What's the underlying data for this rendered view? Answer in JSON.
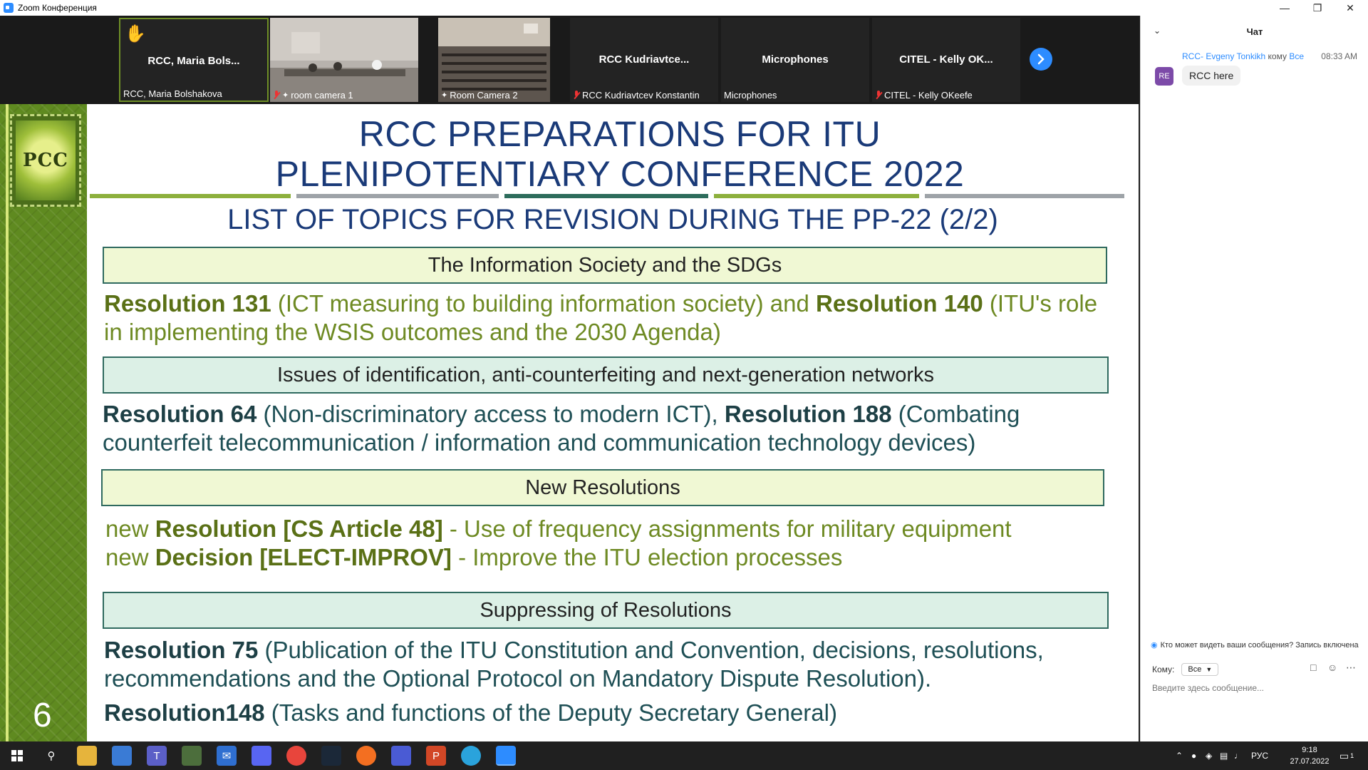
{
  "window": {
    "title": "Zoom Конференция"
  },
  "participants": [
    {
      "center_name": "RCC, Maria Bols...",
      "label": "RCC, Maria Bolshakova",
      "hand_raised": true,
      "muted": false,
      "pinned": false,
      "active": true,
      "video": false
    },
    {
      "center_name": "",
      "label": "room camera 1",
      "hand_raised": false,
      "muted": true,
      "pinned": true,
      "active": false,
      "video": true
    },
    {
      "center_name": "",
      "label": "Room Camera 2",
      "hand_raised": false,
      "muted": false,
      "pinned": true,
      "active": false,
      "video": true
    },
    {
      "center_name": "RCC  Kudriavtce...",
      "label": "RCC Kudriavtcev Konstantin",
      "hand_raised": false,
      "muted": true,
      "pinned": false,
      "active": false,
      "video": false
    },
    {
      "center_name": "Microphones",
      "label": "Microphones",
      "hand_raised": false,
      "muted": false,
      "pinned": false,
      "active": false,
      "video": false
    },
    {
      "center_name": "CITEL - Kelly OK...",
      "label": "CITEL - Kelly OKeefe",
      "hand_raised": false,
      "muted": true,
      "pinned": false,
      "active": false,
      "video": false
    }
  ],
  "slide": {
    "logo_text": "PCC",
    "title_line1": "RCC PREPARATIONS FOR ITU",
    "title_line2": "PLENIPOTENTIARY CONFERENCE 2022",
    "subtitle": "LIST OF TOPICS FOR REVISION DURING THE PP-22 (2/2)",
    "page_number": "6",
    "sections": [
      {
        "heading": "The Information Society and the SDGs"
      },
      {
        "heading": "Issues of identification, anti-counterfeiting and next-generation networks"
      },
      {
        "heading": "New Resolutions"
      },
      {
        "heading": "Suppressing of Resolutions"
      }
    ],
    "p1": {
      "b1": "Resolution 131",
      "t1": " (ICT measuring to building information society) and ",
      "b2": "Resolution 140",
      "t2": " (ITU's role in implementing the WSIS outcomes and the 2030 Agenda)"
    },
    "p2": {
      "b1": "Resolution  64",
      "t1": " (Non-discriminatory access to modern ICT), ",
      "b2": "Resolution 188",
      "t2": " (Combating counterfeit telecommunication / information and communication technology devices)"
    },
    "p3": {
      "pre1": "new ",
      "b1": "Resolution [CS Article 48]",
      "t1": " - Use of frequency assignments for military equipment",
      "pre2": "new ",
      "b2": "Decision [ELECT-IMPROV]",
      "t2": " - Improve the ITU election processes"
    },
    "p4": {
      "b1": "Resolution 75",
      "t1": " (Publication of the ITU Constitution and Convention, decisions, resolutions, recommendations and the Optional Protocol on Mandatory Dispute Resolution)."
    },
    "p5": {
      "b1": "Resolution148",
      "t1": " (Tasks and functions of the Deputy Secretary General)"
    }
  },
  "chat": {
    "title": "Чат",
    "message": {
      "avatar": "RE",
      "sender": "RCC- Evgeny Tonkikh",
      "to_word": "кому",
      "recipient": "Все",
      "time": "08:33 AM",
      "text": "RCC here"
    },
    "privacy_note": "Кто может видеть ваши сообщения? Запись включена",
    "to_label": "Кому:",
    "to_value": "Все",
    "input_placeholder": "Введите здесь сообщение..."
  },
  "taskbar": {
    "language": "РУС",
    "time": "9:18",
    "date": "27.07.2022",
    "notification_count": "1"
  }
}
